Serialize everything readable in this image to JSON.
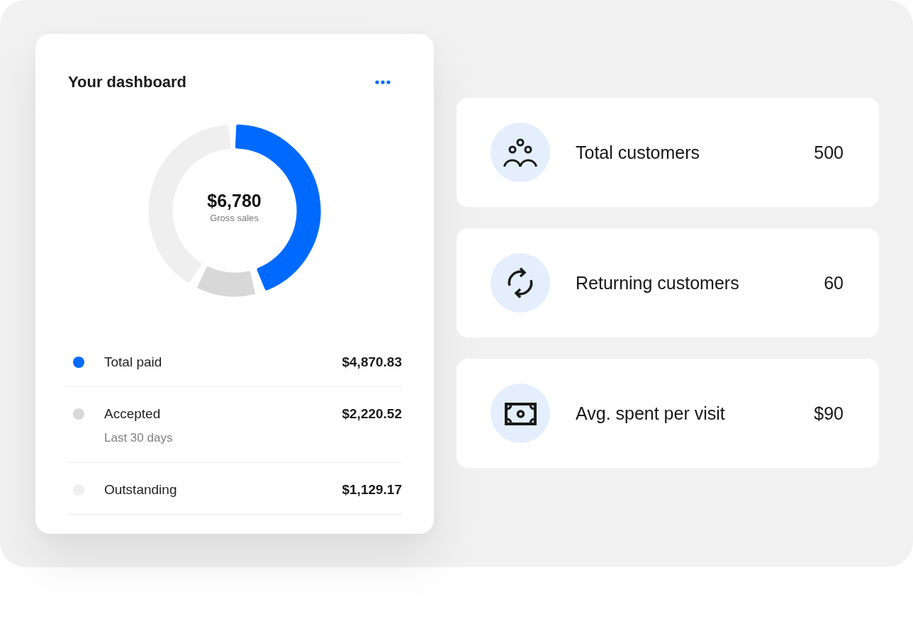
{
  "dashboard_card": {
    "title": "Your dashboard",
    "donut": {
      "amount": "$6,780",
      "caption": "Gross sales"
    },
    "legend": [
      {
        "label": "Total paid",
        "value": "$4,870.83",
        "color": "#006aff"
      },
      {
        "label": "Accepted",
        "sublabel": "Last 30 days",
        "value": "$2,220.52",
        "color": "#d8d8d8"
      },
      {
        "label": "Outstanding",
        "value": "$1,129.17",
        "color": "#efefef"
      }
    ]
  },
  "stats": [
    {
      "label": "Total customers",
      "value": "500"
    },
    {
      "label": "Returning customers",
      "value": "60"
    },
    {
      "label": "Avg. spent per visit",
      "value": "$90"
    }
  ]
}
